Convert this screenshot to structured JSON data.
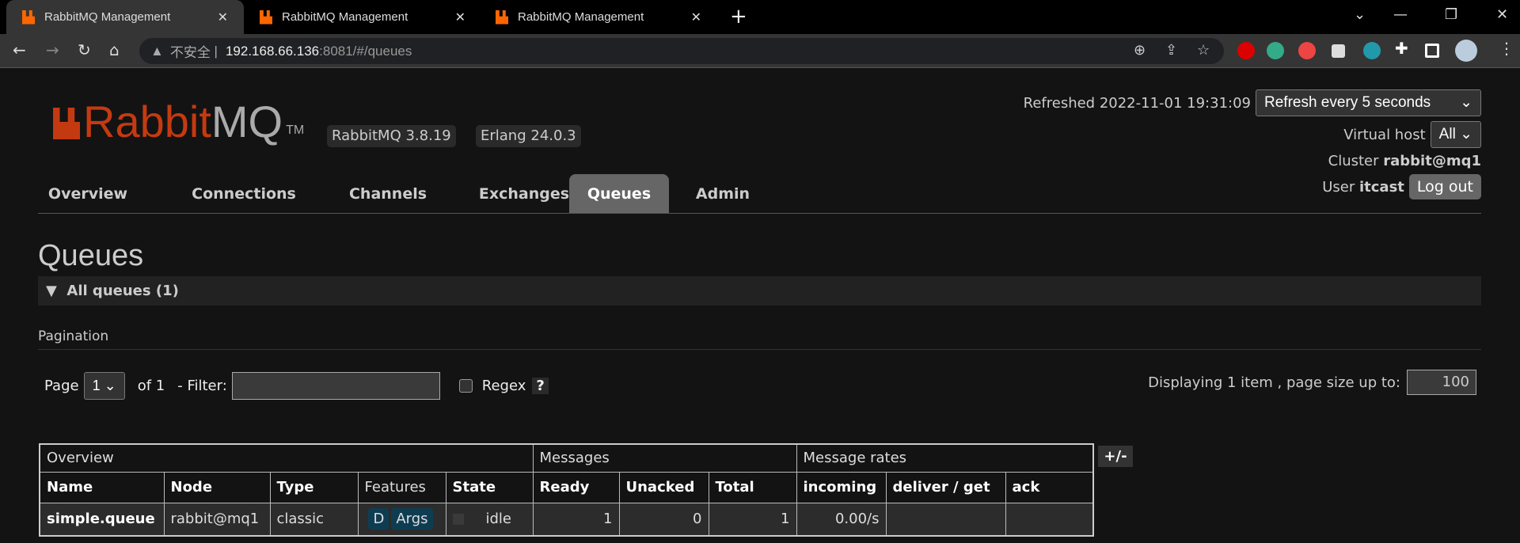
{
  "browser": {
    "tabs": [
      {
        "title": "RabbitMQ Management"
      },
      {
        "title": "RabbitMQ Management"
      },
      {
        "title": "RabbitMQ Management"
      }
    ],
    "address": {
      "insecure_label": "不安全",
      "host": "192.168.66.136",
      "path": ":8081/#/queues"
    }
  },
  "header": {
    "logo_part1": "Rabbit",
    "logo_part2": "MQ",
    "logo_tm": "TM",
    "version_badge": "RabbitMQ 3.8.19",
    "erlang_badge": "Erlang 24.0.3",
    "refreshed": "Refreshed 2022-11-01 19:31:09",
    "refresh_select": "Refresh every 5 seconds",
    "vhost_label": "Virtual host",
    "vhost_value": "All",
    "cluster_label": "Cluster",
    "cluster_value": "rabbit@mq1",
    "user_label": "User",
    "user_value": "itcast",
    "logout": "Log out"
  },
  "nav": {
    "tabs": [
      {
        "label": "Overview"
      },
      {
        "label": "Connections"
      },
      {
        "label": "Channels"
      },
      {
        "label": "Exchanges"
      },
      {
        "label": "Queues",
        "active": true
      },
      {
        "label": "Admin"
      }
    ]
  },
  "page": {
    "title": "Queues",
    "section": "All queues (1)",
    "pagination_label": "Pagination",
    "page_label": "Page",
    "page_value": "1",
    "of_label": "of 1",
    "filter_label": "- Filter:",
    "filter_value": "",
    "regex_label": "Regex",
    "help": "?",
    "displaying": "Displaying 1 item , page size up to:",
    "page_size": "100",
    "toggle_columns": "+/-"
  },
  "table": {
    "groups": [
      "Overview",
      "Messages",
      "Message rates"
    ],
    "columns": [
      "Name",
      "Node",
      "Type",
      "Features",
      "State",
      "Ready",
      "Unacked",
      "Total",
      "incoming",
      "deliver / get",
      "ack"
    ],
    "rows": [
      {
        "name": "simple.queue",
        "node": "rabbit@mq1",
        "type": "classic",
        "features": [
          "D",
          "Args"
        ],
        "state": "idle",
        "ready": "1",
        "unacked": "0",
        "total": "1",
        "incoming": "0.00/s",
        "deliver_get": "",
        "ack": ""
      }
    ]
  }
}
